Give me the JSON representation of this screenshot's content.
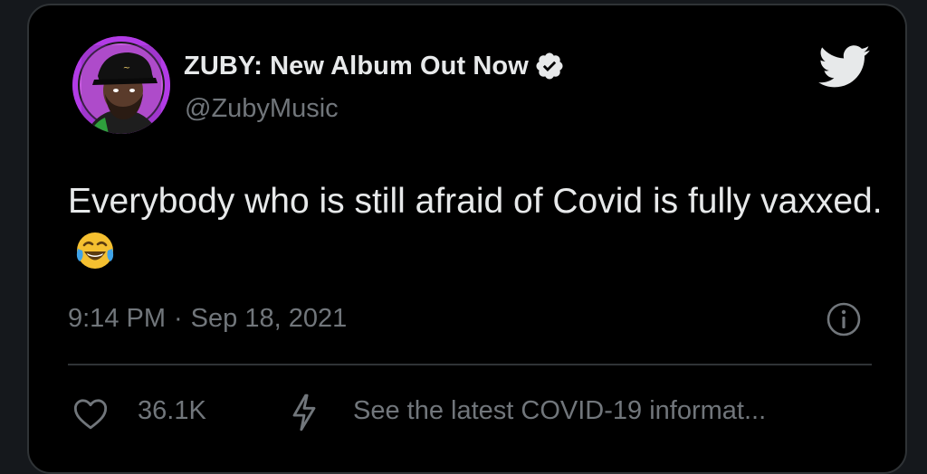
{
  "tweet": {
    "display_name": "ZUBY: New Album Out Now",
    "handle": "@ZubyMusic",
    "text": "Everybody who is still afraid of Covid is fully vaxxed.",
    "time": "9:14 PM",
    "separator": "·",
    "date": "Sep 18, 2021",
    "like_count": "36.1K",
    "covid_notice": "See the latest COVID-19 informat..."
  },
  "icons": {
    "verified": "verified-badge-icon",
    "brand": "twitter-bird-icon",
    "emoji": "face-with-tears-of-joy-emoji",
    "info": "info-icon",
    "like": "heart-icon",
    "notice": "lightning-bolt-icon"
  },
  "colors": {
    "background": "#000000",
    "primary_text": "#e7e9ea",
    "secondary_text": "#71767b",
    "avatar_ring": "#b23be6"
  }
}
